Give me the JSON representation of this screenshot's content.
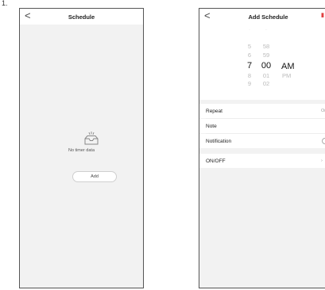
{
  "corner_mark": "1.",
  "screen_schedule": {
    "title": "Schedule",
    "back_glyph": "<",
    "empty_text": "No timer data",
    "add_label": "Add"
  },
  "screen_add": {
    "title": "Add Schedule",
    "back_glyph": "<",
    "picker": {
      "hours": [
        "5",
        "6",
        "7",
        "8",
        "9"
      ],
      "minutes": [
        "58",
        "59",
        "00",
        "01",
        "02"
      ],
      "selected_hour": "7",
      "selected_minute": "00",
      "periods": [
        "AM",
        "PM"
      ],
      "selected_period": "AM"
    },
    "rows": {
      "repeat": "Repeat",
      "repeat_value": "On",
      "note": "Note",
      "notification": "Notification",
      "onoff": "ON/OFF"
    }
  }
}
